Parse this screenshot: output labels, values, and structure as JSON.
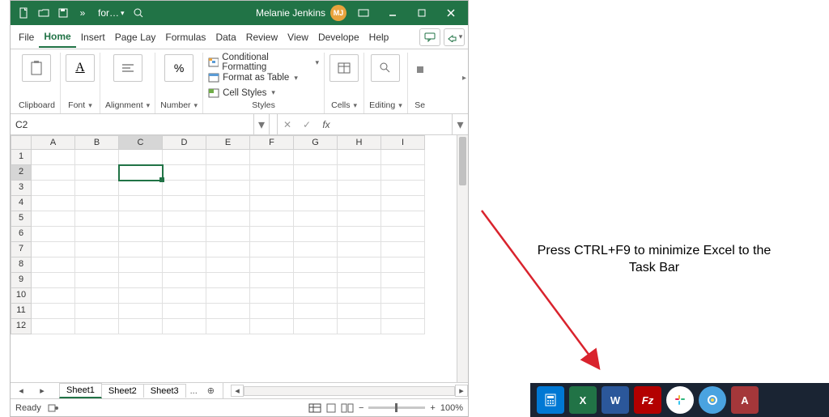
{
  "titlebar": {
    "filename": "for…",
    "user_name": "Melanie Jenkins",
    "user_initials": "MJ"
  },
  "tabs": {
    "file": "File",
    "home": "Home",
    "insert": "Insert",
    "pagelayout": "Page Lay",
    "formulas": "Formulas",
    "data": "Data",
    "review": "Review",
    "view": "View",
    "developer": "Develope",
    "help": "Help"
  },
  "ribbon": {
    "clipboard": "Clipboard",
    "font": "Font",
    "alignment": "Alignment",
    "number": "Number",
    "styles": "Styles",
    "cells": "Cells",
    "editing": "Editing",
    "sensitivity": "Se",
    "cond_fmt": "Conditional Formatting",
    "fmt_table": "Format as Table",
    "cell_styles": "Cell Styles"
  },
  "formula_bar": {
    "name_box": "C2"
  },
  "grid": {
    "columns": [
      "A",
      "B",
      "C",
      "D",
      "E",
      "F",
      "G",
      "H",
      "I"
    ],
    "selected_col": "C",
    "rows": [
      1,
      2,
      3,
      4,
      5,
      6,
      7,
      8,
      9,
      10,
      11,
      12
    ],
    "selected_row": 2
  },
  "sheets": {
    "s1": "Sheet1",
    "s2": "Sheet2",
    "s3": "Sheet3",
    "more": "..."
  },
  "statusbar": {
    "ready": "Ready",
    "zoom": "100%"
  },
  "annotation": {
    "text": "Press CTRL+F9 to minimize Excel to the Task Bar"
  }
}
